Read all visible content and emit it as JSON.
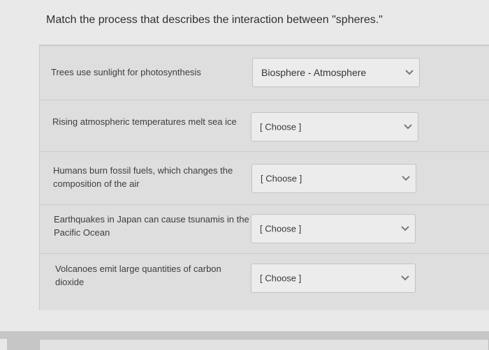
{
  "question": {
    "prompt": "Match the process that describes the interaction between \"spheres.\""
  },
  "rows": [
    {
      "text": "Trees use sunlight for photosynthesis",
      "selected": "Biosphere - Atmosphere"
    },
    {
      "text": "Rising atmospheric temperatures melt sea ice",
      "selected": "[ Choose ]"
    },
    {
      "text": "Humans burn fossil fuels, which changes the composition of the air",
      "selected": "[ Choose ]"
    },
    {
      "text": "Earthquakes in Japan can cause tsunamis in the Pacific Ocean",
      "selected": "[ Choose ]"
    },
    {
      "text": "Volcanoes emit large quantities of carbon dioxide",
      "selected": "[ Choose ]"
    }
  ],
  "icons": {
    "dropdown": "chevron-down-icon"
  },
  "colors": {
    "chevron": "#7a7a7a"
  }
}
